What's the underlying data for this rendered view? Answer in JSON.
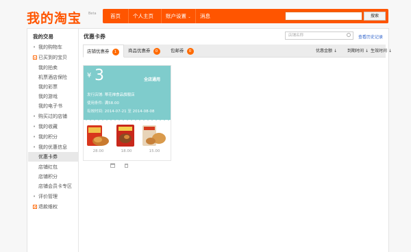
{
  "header": {
    "logo": "我的淘宝",
    "beta": "Beta",
    "nav": [
      {
        "label": "首页"
      },
      {
        "label": "个人主页"
      },
      {
        "label": "账户设置"
      },
      {
        "label": "消息"
      }
    ],
    "search_button": "搜索"
  },
  "sidebar": {
    "title": "我的交易",
    "items": [
      {
        "label": "我的购物车"
      },
      {
        "label": "已买到的宝贝"
      },
      {
        "label": "我的拍卖"
      },
      {
        "label": "机票酒店保险"
      },
      {
        "label": "我的彩票"
      },
      {
        "label": "我的游戏"
      },
      {
        "label": "我的电子书"
      },
      {
        "label": "购买过的店铺"
      },
      {
        "label": "我的收藏"
      },
      {
        "label": "我的积分"
      },
      {
        "label": "我的优惠信息"
      },
      {
        "label": "优惠卡券"
      },
      {
        "label": "店铺红包"
      },
      {
        "label": "店铺积分"
      },
      {
        "label": "店铺会员卡专区"
      },
      {
        "label": "评价管理"
      },
      {
        "label": "退款维权"
      }
    ]
  },
  "content": {
    "title": "优惠卡券",
    "filter_placeholder": "店铺名称",
    "history_link": "查看历史记录",
    "tabs": [
      {
        "label": "店铺优惠券",
        "count": "1"
      },
      {
        "label": "商品优惠券",
        "count": "0"
      },
      {
        "label": "包邮券",
        "count": "0"
      }
    ],
    "sorts": [
      {
        "label": "优惠金额"
      },
      {
        "label": "到期时间"
      },
      {
        "label": "生效时间"
      }
    ]
  },
  "coupon": {
    "currency": "¥",
    "amount": "3",
    "scope": "全店通用",
    "issuer_label": "发行店铺:",
    "issuer": "蒂花禅食品旗舰店",
    "condition_label": "使用条件:",
    "condition": "满58.00",
    "validity_label": "有效时间:",
    "validity_start": "2014-07-21",
    "validity_sep": "至",
    "validity_end": "2014-08-08",
    "products": [
      {
        "price": "28.00"
      },
      {
        "price": "18.00"
      },
      {
        "price": "15.00"
      }
    ]
  },
  "colors": {
    "brand": "#ff5500",
    "coupon": "#7fcccc",
    "badge": "#ff6a00",
    "link": "#3366cc"
  },
  "icons": [
    "search-icon",
    "chevron-down-icon",
    "sort-arrow-icon",
    "calendar-icon",
    "trash-icon"
  ]
}
